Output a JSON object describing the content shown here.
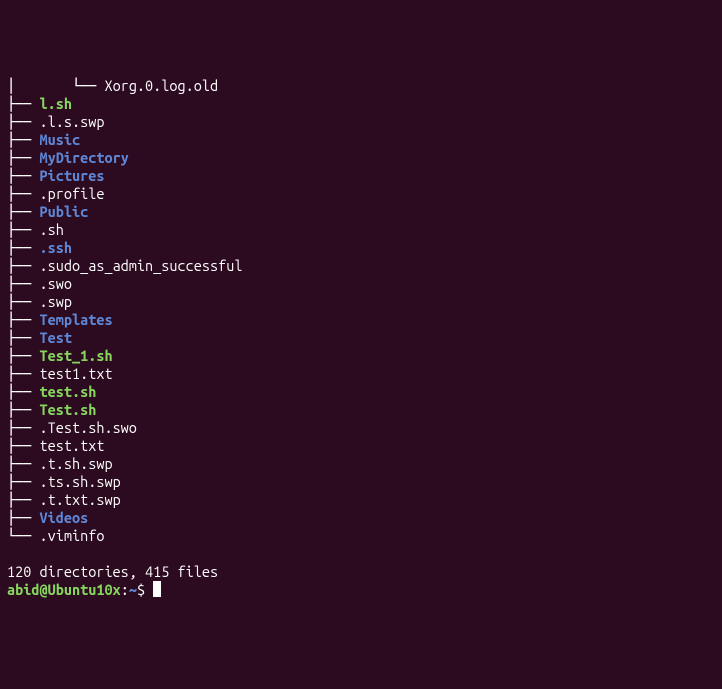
{
  "tree": [
    {
      "indent": "│       └── ",
      "name": "Xorg.0.log.old",
      "type": "file"
    },
    {
      "indent": "├── ",
      "name": "l.sh",
      "type": "exec"
    },
    {
      "indent": "├── ",
      "name": ".l.s.swp",
      "type": "file"
    },
    {
      "indent": "├── ",
      "name": "Music",
      "type": "dir"
    },
    {
      "indent": "├── ",
      "name": "MyDirectory",
      "type": "dir"
    },
    {
      "indent": "├── ",
      "name": "Pictures",
      "type": "dir"
    },
    {
      "indent": "├── ",
      "name": ".profile",
      "type": "file"
    },
    {
      "indent": "├── ",
      "name": "Public",
      "type": "dir"
    },
    {
      "indent": "├── ",
      "name": ".sh",
      "type": "file"
    },
    {
      "indent": "├── ",
      "name": ".ssh",
      "type": "dir"
    },
    {
      "indent": "├── ",
      "name": ".sudo_as_admin_successful",
      "type": "file"
    },
    {
      "indent": "├── ",
      "name": ".swo",
      "type": "file"
    },
    {
      "indent": "├── ",
      "name": ".swp",
      "type": "file"
    },
    {
      "indent": "├── ",
      "name": "Templates",
      "type": "dir"
    },
    {
      "indent": "├── ",
      "name": "Test",
      "type": "dir"
    },
    {
      "indent": "├── ",
      "name": "Test_1.sh",
      "type": "exec"
    },
    {
      "indent": "├── ",
      "name": "test1.txt",
      "type": "file"
    },
    {
      "indent": "├── ",
      "name": "test.sh",
      "type": "exec"
    },
    {
      "indent": "├── ",
      "name": "Test.sh",
      "type": "exec"
    },
    {
      "indent": "├── ",
      "name": ".Test.sh.swo",
      "type": "file"
    },
    {
      "indent": "├── ",
      "name": "test.txt",
      "type": "file"
    },
    {
      "indent": "├── ",
      "name": ".t.sh.swp",
      "type": "file"
    },
    {
      "indent": "├── ",
      "name": ".ts.sh.swp",
      "type": "file"
    },
    {
      "indent": "├── ",
      "name": ".t.txt.swp",
      "type": "file"
    },
    {
      "indent": "├── ",
      "name": "Videos",
      "type": "dir"
    },
    {
      "indent": "└── ",
      "name": ".viminfo",
      "type": "file"
    }
  ],
  "summary": "120 directories, 415 files",
  "prompt": {
    "user_host": "abid@Ubuntu10x",
    "colon": ":",
    "path": "~",
    "dollar": "$ "
  }
}
